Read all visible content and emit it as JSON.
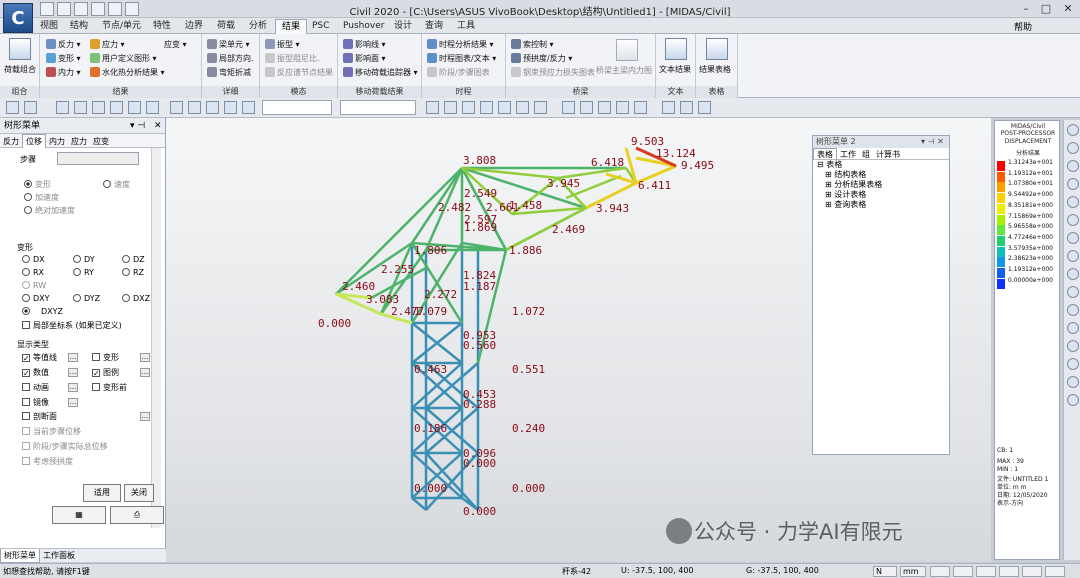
{
  "app": {
    "window_title": "Civil 2020 - [C:\\Users\\ASUS VivoBook\\Desktop\\结构\\Untitled1] - [MIDAS/Civil]",
    "logo": "C",
    "help_label": "帮助"
  },
  "menu": {
    "tabs": [
      "视图",
      "结构",
      "节点/单元",
      "特性",
      "边界",
      "荷载",
      "分析",
      "结果",
      "PSC",
      "Pushover",
      "设计",
      "查询",
      "工具"
    ],
    "active": "结果"
  },
  "ribbon": {
    "g1": {
      "items": [
        "荷载组合"
      ],
      "title": "组合"
    },
    "g2": {
      "items": [
        "反力",
        "应力",
        "应变",
        "变形",
        "用户定义图形",
        "内力",
        "水化热分析结果"
      ],
      "title": "结果"
    },
    "g3": {
      "items": [
        "梁单元",
        "局部方向.",
        "弯矩折减"
      ],
      "title": "详细"
    },
    "g4": {
      "items": [
        "振型",
        "振型阻尼比.",
        "反应谱节点结果"
      ],
      "title": "模态"
    },
    "g5": {
      "items": [
        "影响线",
        "影响面",
        "移动荷载追踪器"
      ],
      "title": "移动荷载结果"
    },
    "g6": {
      "items": [
        "时程分析结果",
        "时程图表/文本",
        "阶段/步骤图表"
      ],
      "title": "时程"
    },
    "g7": {
      "items": [
        "索控制",
        "预拱度/反力",
        "钢束预应力损失图表",
        "桥梁主梁内力图"
      ],
      "title": "桥梁"
    },
    "g8": {
      "items": [
        "文本结果"
      ],
      "title": "文本"
    },
    "g9": {
      "items": [
        "结果表格"
      ],
      "title": "表格"
    }
  },
  "left_panel": {
    "title": "树形菜单",
    "tabs": [
      "反力",
      "位移",
      "内力",
      "应力",
      "应变"
    ],
    "active_tab": "位移",
    "step_label": "步骤",
    "motion": {
      "disp": "变形",
      "vel": "速度",
      "acc": "加速度",
      "abs_acc": "绝对加速度"
    },
    "deform_section": "变形",
    "components": [
      "DX",
      "DY",
      "DZ",
      "RX",
      "RY",
      "RZ",
      "RW",
      "DXY",
      "DYZ",
      "DXZ",
      "DXYZ"
    ],
    "selected_component": "DXYZ",
    "local_axis": "局部坐标系 (如果已定义)",
    "display_section": "显示类型",
    "display_options": {
      "contour": "等值线",
      "deform": "变形",
      "values": "数值",
      "legend": "图例",
      "animate": "动画",
      "undeformed": "变形前",
      "mirror": "镜像",
      "cutting_plane": "剖断面"
    },
    "current_step": "当前步骤位移",
    "stage_step": "阶段/步骤实际总位移",
    "camber": "考虑预拱度",
    "dots": "...",
    "apply": "适用",
    "close": "关闭",
    "bottom_tabs": [
      "树形菜单",
      "工作面板"
    ]
  },
  "float_panel": {
    "title": "树形菜单 2",
    "tabs": [
      "表格",
      "工作",
      "组",
      "计算书"
    ],
    "tree": [
      "表格",
      "结构表格",
      "分析结果表格",
      "设计表格",
      "查询表格"
    ]
  },
  "legend": {
    "header": [
      "MIDAS/Civil",
      "POST-PROCESSOR",
      "DISPLACEMENT",
      "分析结果"
    ],
    "values": [
      "1.31243e+001",
      "1.19312e+001",
      "1.07380e+001",
      "9.54492e+000",
      "8.35181e+000",
      "7.15869e+000",
      "5.96558e+000",
      "4.77246e+000",
      "3.57935e+000",
      "2.38623e+000",
      "1.19312e+000",
      "0.00000e+000"
    ],
    "colors": [
      "#ff0000",
      "#ff5a00",
      "#ffa000",
      "#ffd000",
      "#e8f000",
      "#a8f000",
      "#60e840",
      "#20d070",
      "#10c0b8",
      "#1098e8",
      "#1060f0",
      "#1030ff"
    ],
    "footer": [
      "CB: 1",
      "MAX : 39",
      "MIN : 1",
      "文件: UNTITLED 1",
      "单位: m m",
      "日期: 12/05/2020",
      "表示-方向"
    ]
  },
  "model_labels": [
    "9.503",
    "13.124",
    "9.495",
    "3.808",
    "6.418",
    "3.945",
    "6.411",
    "2.549",
    "2.482",
    "2.661",
    "1.458",
    "3.943",
    "2.597",
    "1.869",
    "2.469",
    "1.806",
    "1.886",
    "2.255",
    "1.824",
    "1.187",
    "2.460",
    "2.272",
    "3.083",
    "2.477",
    "1.079",
    "1.072",
    "0.000",
    "0.953",
    "0.560",
    "0.463",
    "0.551",
    "0.453",
    "0.288",
    "0.186",
    "0.240",
    "0.096",
    "0.000",
    "0.000",
    "0.000",
    "0.000",
    "0.000"
  ],
  "status": {
    "help_text": "如想查找帮助, 请按F1键",
    "element": "杆系-42",
    "u_coord": "U: -37.5, 100, 400",
    "g_coord": "G: -37.5, 100, 400",
    "unit": "N",
    "unit2": "mm"
  },
  "watermark": "公众号 · 力学AI有限元",
  "colors": {
    "tab_active": "#f7f9fb",
    "label": "#8b0a14",
    "frame": "#3a8fb5"
  }
}
